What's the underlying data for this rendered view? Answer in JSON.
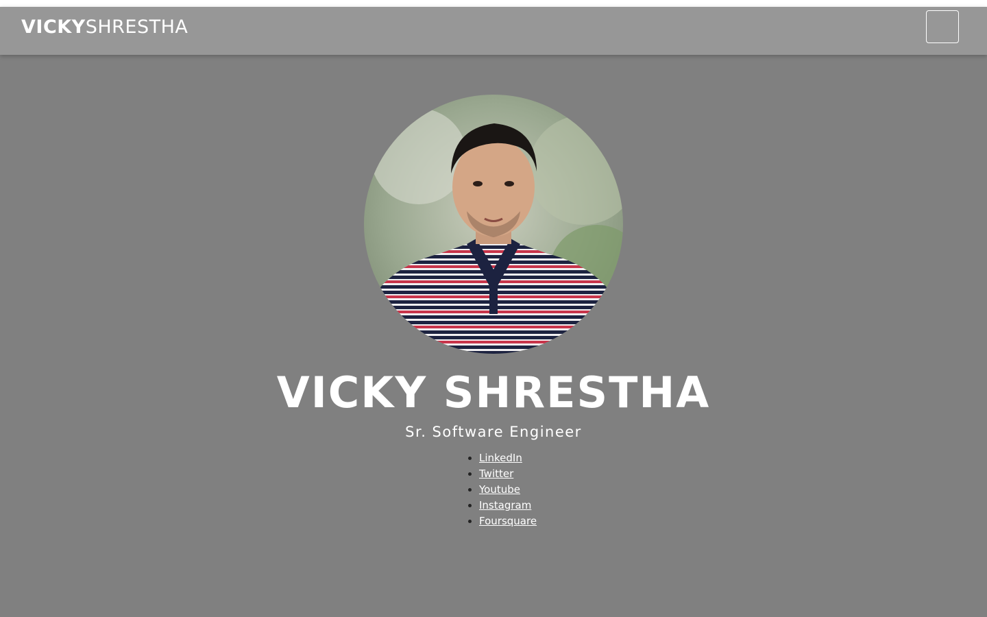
{
  "navbar": {
    "brand_first": "VICKY",
    "brand_last": "SHRESTHA",
    "menu_icon": "menu-toggle-icon"
  },
  "hero": {
    "name": "VICKY SHRESTHA",
    "title": "Sr. Software Engineer",
    "social_links": [
      {
        "label": "LinkedIn"
      },
      {
        "label": "Twitter"
      },
      {
        "label": "Youtube"
      },
      {
        "label": "Instagram"
      },
      {
        "label": "Foursquare"
      }
    ]
  },
  "colors": {
    "page_background": "#808080",
    "navbar_background": "#979797",
    "text": "#ffffff"
  }
}
